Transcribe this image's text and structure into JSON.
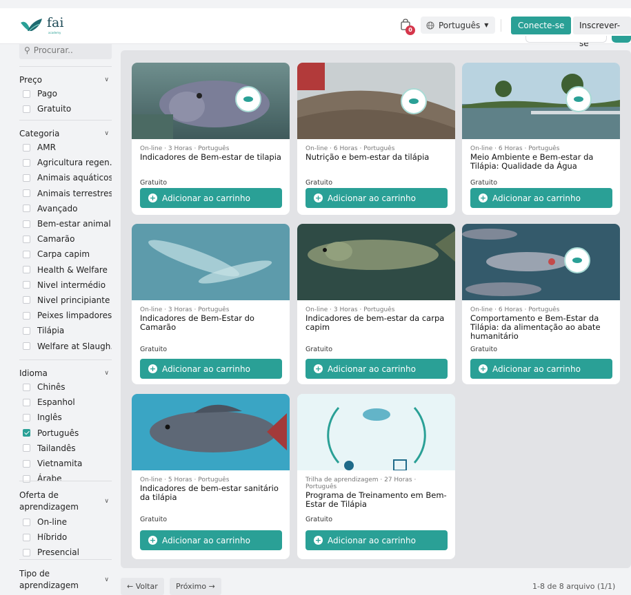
{
  "header": {
    "logo_text": "fai",
    "logo_sub": "academy",
    "cart_count": "0",
    "language": "Português",
    "login_label": "Conecte-se",
    "register_label": "Inscrever-se"
  },
  "sidebar": {
    "search_placeholder": "Procurar..",
    "groups": [
      {
        "title": "Preço",
        "items": [
          {
            "label": "Pago"
          },
          {
            "label": "Gratuito"
          }
        ]
      },
      {
        "title": "Categoria",
        "items": [
          {
            "label": "AMR"
          },
          {
            "label": "Agricultura regen..."
          },
          {
            "label": "Animais aquáticos"
          },
          {
            "label": "Animais terrestres"
          },
          {
            "label": "Avançado"
          },
          {
            "label": "Bem-estar animal"
          },
          {
            "label": "Camarão"
          },
          {
            "label": "Carpa capim"
          },
          {
            "label": "Health & Welfare"
          },
          {
            "label": "Nivel intermédio"
          },
          {
            "label": "Nivel principiante"
          },
          {
            "label": "Peixes limpadores"
          },
          {
            "label": "Tilápia"
          },
          {
            "label": "Welfare at Slaugh..."
          }
        ]
      },
      {
        "title": "Idioma",
        "items": [
          {
            "label": "Chinês"
          },
          {
            "label": "Espanhol"
          },
          {
            "label": "Inglês"
          },
          {
            "label": "Português",
            "checked": true
          },
          {
            "label": "Tailandês"
          },
          {
            "label": "Vietnamita"
          },
          {
            "label": "Árabe"
          }
        ]
      },
      {
        "title": "Oferta de aprendizagem",
        "items": [
          {
            "label": "On-line"
          },
          {
            "label": "Híbrido"
          },
          {
            "label": "Presencial"
          }
        ]
      },
      {
        "title": "Tipo de aprendizagem",
        "items": []
      }
    ]
  },
  "courses": [
    {
      "meta": "On-line · 3 Horas · Português",
      "title": "Indicadores de Bem-estar de tilapia",
      "price": "Gratuito",
      "button": "Adicionar ao carrinho"
    },
    {
      "meta": "On-line · 6 Horas · Português",
      "title": "Nutrição e bem-estar da tilápia",
      "price": "Gratuito",
      "button": "Adicionar ao carrinho"
    },
    {
      "meta": "On-line · 6 Horas · Português",
      "title": "Meio Ambiente e Bem-estar da Tilápia: Qualidade da Água",
      "price": "Gratuito",
      "button": "Adicionar ao carrinho"
    },
    {
      "meta": "On-line · 3 Horas · Português",
      "title": "Indicadores de Bem-Estar do Camarão",
      "price": "Gratuito",
      "button": "Adicionar ao carrinho"
    },
    {
      "meta": "On-line · 3 Horas · Português",
      "title": "Indicadores de bem-estar da carpa capim",
      "price": "Gratuito",
      "button": "Adicionar ao carrinho"
    },
    {
      "meta": "On-line · 6 Horas · Português",
      "title": "Comportamento e Bem-Estar da Tilápia: da alimentação ao abate humanitário",
      "price": "Gratuito",
      "button": "Adicionar ao carrinho"
    },
    {
      "meta": "On-line · 5 Horas · Português",
      "title": "Indicadores de bem-estar sanitário da tilápia",
      "price": "Gratuito",
      "button": "Adicionar ao carrinho"
    },
    {
      "meta": "Trilha de aprendizagem · 27 Horas · Português",
      "title": "Programa de Treinamento em Bem-Estar de Tilápia",
      "price": "Gratuito",
      "button": "Adicionar ao carrinho"
    }
  ],
  "pager": {
    "prev": "← Voltar",
    "next": "Próximo →",
    "info": "1-8 de 8 arquivo (1/1)"
  },
  "colors": {
    "accent": "#2aa096",
    "badge": "#d5364b"
  }
}
